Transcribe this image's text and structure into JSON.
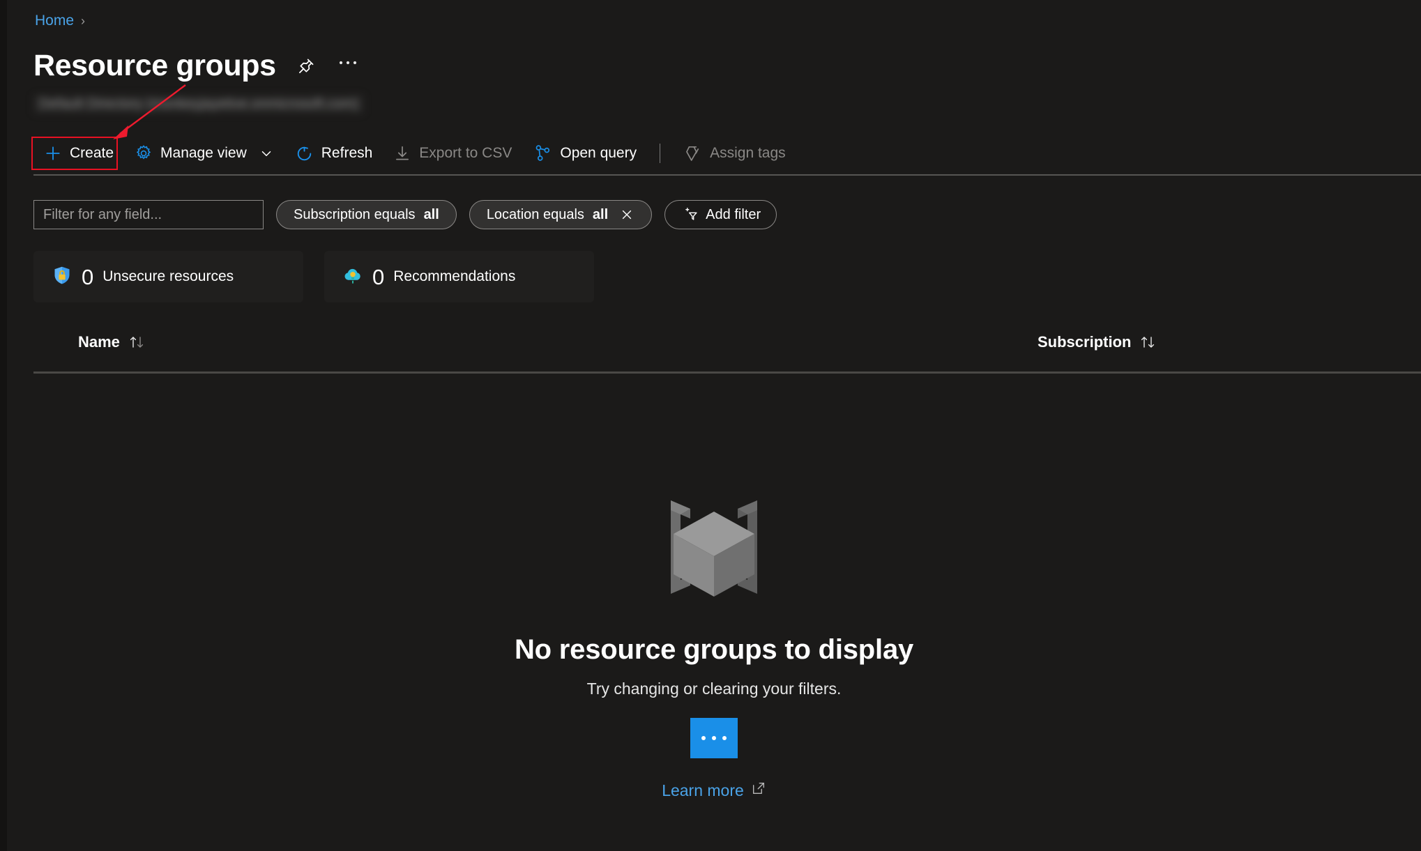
{
  "breadcrumb": {
    "home": "Home",
    "separator": "›"
  },
  "header": {
    "title": "Resource groups",
    "pin_icon": "pin-icon",
    "more_icon": "ellipsis-icon",
    "subtitle_redacted": "Default Directory (monkeyjayetive.onmicrosoft.com)"
  },
  "commandbar": {
    "items": [
      {
        "label": "Create",
        "icon": "plus-icon",
        "disabled": false
      },
      {
        "label": "Manage view",
        "icon": "gear-icon",
        "disabled": false,
        "chevron": true
      },
      {
        "label": "Refresh",
        "icon": "refresh-icon",
        "disabled": false
      },
      {
        "label": "Export to CSV",
        "icon": "download-icon",
        "disabled": true
      },
      {
        "label": "Open query",
        "icon": "query-graph-icon",
        "disabled": false
      },
      {
        "label": "Assign tags",
        "icon": "tag-icon",
        "disabled": true
      }
    ]
  },
  "filters": {
    "search_placeholder": "Filter for any field...",
    "search_value": "",
    "chips": [
      {
        "prefix": "Subscription equals",
        "value": "all",
        "removable": false
      },
      {
        "prefix": "Location equals",
        "value": "all",
        "removable": true
      }
    ],
    "add_filter_label": "Add filter"
  },
  "stats": [
    {
      "icon": "shield-lock-icon",
      "count": "0",
      "label": "Unsecure resources"
    },
    {
      "icon": "cloud-advisor-icon",
      "count": "0",
      "label": "Recommendations"
    }
  ],
  "table": {
    "columns": [
      {
        "label": "Name",
        "sortable": true
      },
      {
        "label": "Subscription",
        "sortable": true
      }
    ]
  },
  "empty_state": {
    "illustration": "resource-cube-icon",
    "title": "No resource groups to display",
    "subtitle": "Try changing or clearing your filters.",
    "button_label": "…",
    "link_label": "Learn more",
    "link_icon": "external-link-icon"
  },
  "annotation": {
    "target": "Create",
    "color": "#e81123"
  },
  "colors": {
    "background": "#1b1a19",
    "card_background": "#201f1e",
    "accent_blue": "#1a8fe8",
    "link_blue": "#4aa3e8",
    "annotation_red": "#e81123",
    "disabled_text": "#8a8886"
  }
}
